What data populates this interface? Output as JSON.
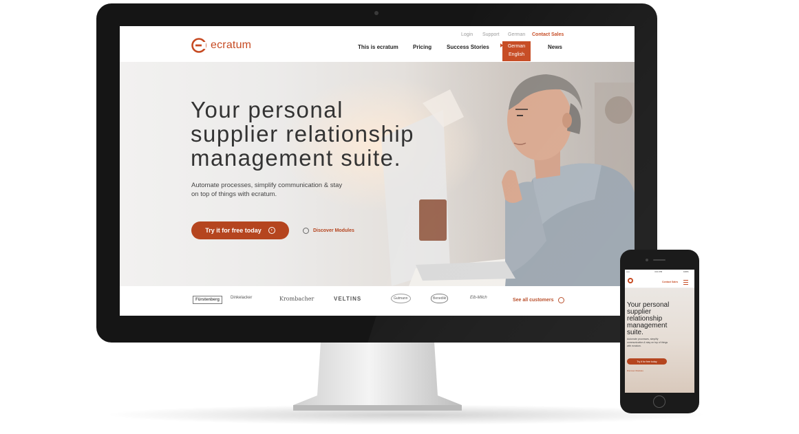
{
  "site": {
    "logo_text": "ecratum",
    "top_links": {
      "login": "Login",
      "support": "Support",
      "language": "German",
      "contact_sales": "Contact Sales"
    },
    "nav": {
      "about": "This is ecratum",
      "pricing": "Pricing",
      "success": "Success Stories",
      "news": "News"
    },
    "language_dropdown": [
      "German",
      "English"
    ],
    "hero": {
      "title_lines": [
        "Your personal",
        "supplier relationship",
        "management suite."
      ],
      "subtitle": "Automate processes, simplify communication & stay on top of things with ecratum.",
      "cta_label": "Try it for free today",
      "discover_label": "Discover Modules"
    },
    "customers": {
      "logos": [
        "Fürstenberg",
        "Dinkelacker",
        "Krombacher",
        "VELTINS",
        "Gutmann",
        "Benedikt",
        "Elb-Milch"
      ],
      "see_all_label": "See all customers"
    }
  },
  "phone_site": {
    "status_left": "••••• ",
    "status_time": "4:21 PM",
    "status_right": "100%",
    "contact_sales": "Contact Sales",
    "title_lines": [
      "Your personal",
      "supplier",
      "relationship",
      "management",
      "suite."
    ],
    "subtitle": "Automate processes, simplify communication & stay on top of things with ecratum.",
    "cta_label": "Try it for free today",
    "discover_label": "Discover Modules"
  },
  "colors": {
    "brand": "#c64a22",
    "cta": "#b5451f",
    "device_bezel": "#151515"
  },
  "icons": [
    "ecratum-logo-icon",
    "arrow-circle-icon",
    "discover-icon",
    "menu-icon"
  ]
}
